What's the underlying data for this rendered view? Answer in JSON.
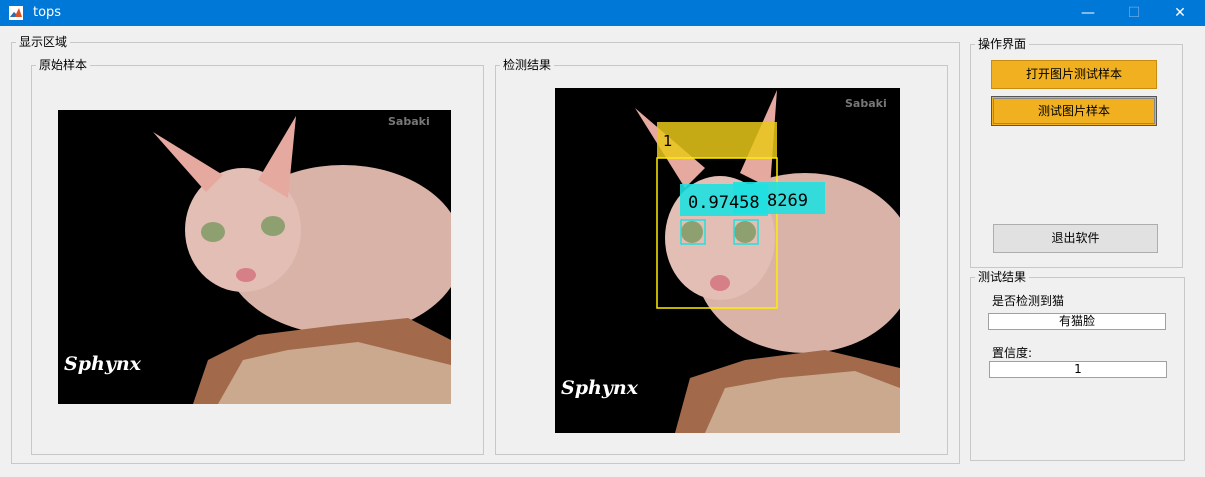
{
  "window": {
    "title": "tops",
    "minimize": "—",
    "maximize": "☐",
    "close": "✕"
  },
  "display_area": {
    "legend": "显示区域",
    "original": {
      "legend": "原始样本",
      "watermark": "Sabaki",
      "caption": "Sphynx"
    },
    "result": {
      "legend": "检测结果",
      "watermark": "Sabaki",
      "caption": "Sphynx",
      "face_label": "1",
      "eye_label_left": "0.97458",
      "eye_label_right": "8269"
    }
  },
  "operations": {
    "legend": "操作界面",
    "open_button": "打开图片测试样本",
    "test_button": "测试图片样本",
    "exit_button": "退出软件"
  },
  "results": {
    "legend": "测试结果",
    "detected_label": "是否检测到猫",
    "detected_value": "有猫脸",
    "confidence_label": "置信度:",
    "confidence_value": "1"
  },
  "colors": {
    "titlebar": "#0078d7",
    "button_accent": "#f0b020",
    "face_box": "#ffee00",
    "eye_box": "#20e0e0"
  }
}
